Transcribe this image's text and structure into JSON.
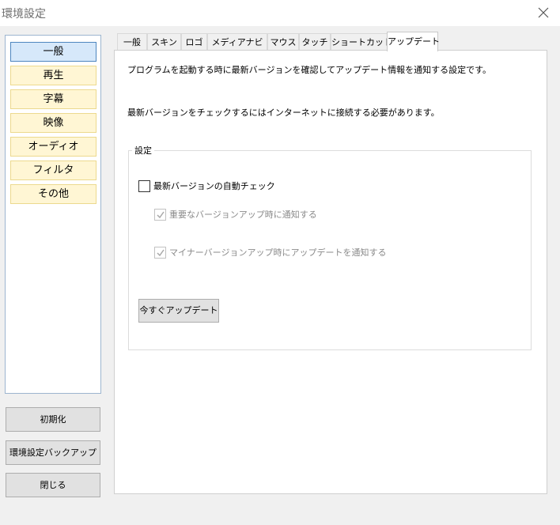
{
  "window": {
    "title": "環境設定",
    "close_icon": "close-icon"
  },
  "sidebar": {
    "items": [
      {
        "label": "一般",
        "selected": true
      },
      {
        "label": "再生"
      },
      {
        "label": "字幕"
      },
      {
        "label": "映像"
      },
      {
        "label": "オーディオ"
      },
      {
        "label": "フィルタ"
      },
      {
        "label": "その他"
      }
    ]
  },
  "footer_buttons": {
    "init": "初期化",
    "backup": "環境設定バックアップ",
    "close": "閉じる"
  },
  "tabs": [
    {
      "label": "一般"
    },
    {
      "label": "スキン"
    },
    {
      "label": "ロゴ"
    },
    {
      "label": "メディアナビ"
    },
    {
      "label": "マウス"
    },
    {
      "label": "タッチ"
    },
    {
      "label": "ショートカット"
    },
    {
      "label": "アップデート",
      "active": true
    }
  ],
  "panel": {
    "description": "プログラムを起動する時に最新バージョンを確認してアップデート情報を通知する設定です。",
    "note": "最新バージョンをチェックするにはインターネットに接続する必要があります。",
    "group_label": "設定",
    "auto_check": {
      "label": "最新バージョンの自動チェック",
      "checked": false
    },
    "notify_major": {
      "label": "重要なバージョンアップ時に通知する",
      "checked": true,
      "disabled": true
    },
    "notify_minor": {
      "label": "マイナーバージョンアップ時にアップデートを通知する",
      "checked": true,
      "disabled": true
    },
    "update_now": "今すぐアップデート"
  },
  "colors": {
    "selected_item_bg": "#d6e8fa",
    "item_bg": "#fff6d4",
    "item_border": "#ecd98e",
    "sidebar_border": "#9db5cf"
  }
}
